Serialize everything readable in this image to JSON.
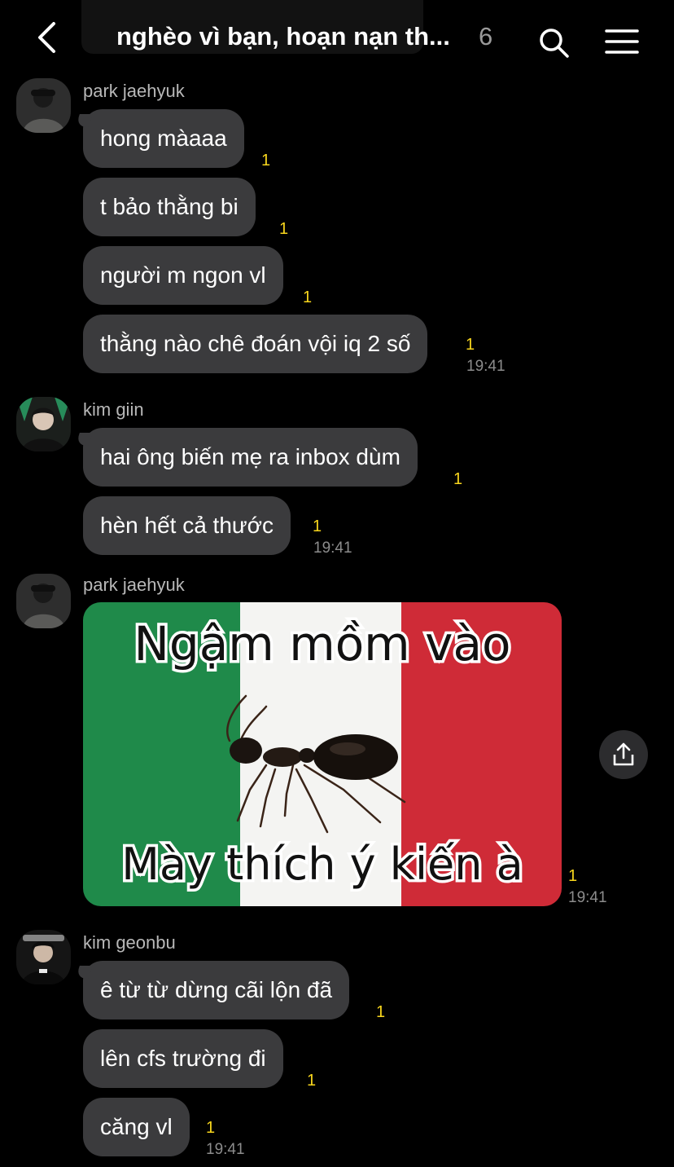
{
  "header": {
    "title": "nghèo vì bạn, hoạn nạn th...",
    "member_count": "6"
  },
  "messages": {
    "group1": {
      "sender": "park jaehyuk",
      "bubbles": [
        {
          "text": "hong màaaa",
          "unread": "1"
        },
        {
          "text": "t bảo thằng bi",
          "unread": "1"
        },
        {
          "text": "người m ngon vl",
          "unread": "1"
        },
        {
          "text": "thằng nào chê đoán vội iq 2 số",
          "unread": "1"
        }
      ],
      "time": "19:41"
    },
    "group2": {
      "sender": "kim giin",
      "bubbles": [
        {
          "text": "hai ông biến mẹ ra inbox dùm",
          "unread": "1"
        },
        {
          "text": "hèn hết cả thước",
          "unread": "1"
        }
      ],
      "time": "19:41"
    },
    "group3": {
      "sender": "park jaehyuk",
      "image": {
        "top_text": "Ngậm mồm vào",
        "bottom_text": "Mày thích ý kiến à"
      },
      "unread": "1",
      "time": "19:41"
    },
    "group4": {
      "sender": "kim geonbu",
      "bubbles": [
        {
          "text": "ê từ từ dừng cãi lộn đã",
          "unread": "1"
        },
        {
          "text": "lên cfs trường đi",
          "unread": "1"
        },
        {
          "text": "căng vl",
          "unread": "1"
        }
      ],
      "time": "19:41"
    }
  },
  "colors": {
    "background": "#000000",
    "bubble": "#3b3b3d",
    "unread": "#f7d51d",
    "flag_green": "#1f8a4a",
    "flag_white": "#f4f4f2",
    "flag_red": "#cf2b37"
  },
  "icons": {
    "back": "chevron-left-icon",
    "search": "search-icon",
    "menu": "hamburger-menu-icon",
    "share": "share-icon"
  }
}
